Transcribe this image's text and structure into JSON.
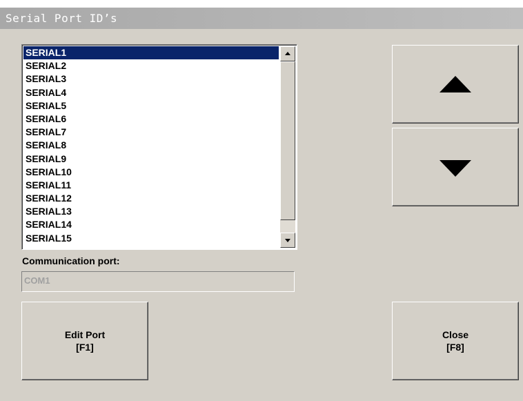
{
  "window": {
    "title": "Serial Port ID’s"
  },
  "port_list": {
    "items": [
      "SERIAL1",
      "SERIAL2",
      "SERIAL3",
      "SERIAL4",
      "SERIAL5",
      "SERIAL6",
      "SERIAL7",
      "SERIAL8",
      "SERIAL9",
      "SERIAL10",
      "SERIAL11",
      "SERIAL12",
      "SERIAL13",
      "SERIAL14",
      "SERIAL15"
    ],
    "selected": "SERIAL1"
  },
  "communication_port": {
    "label": "Communication port:",
    "value": "COM1"
  },
  "buttons": {
    "edit_port": {
      "line1": "Edit Port",
      "line2": "[F1]"
    },
    "close": {
      "line1": "Close",
      "line2": "[F8]"
    },
    "move_up_icon": "triangle-up",
    "move_down_icon": "triangle-down"
  },
  "colors": {
    "selection_bg": "#0a246a",
    "window_bg": "#d4d0c8"
  }
}
